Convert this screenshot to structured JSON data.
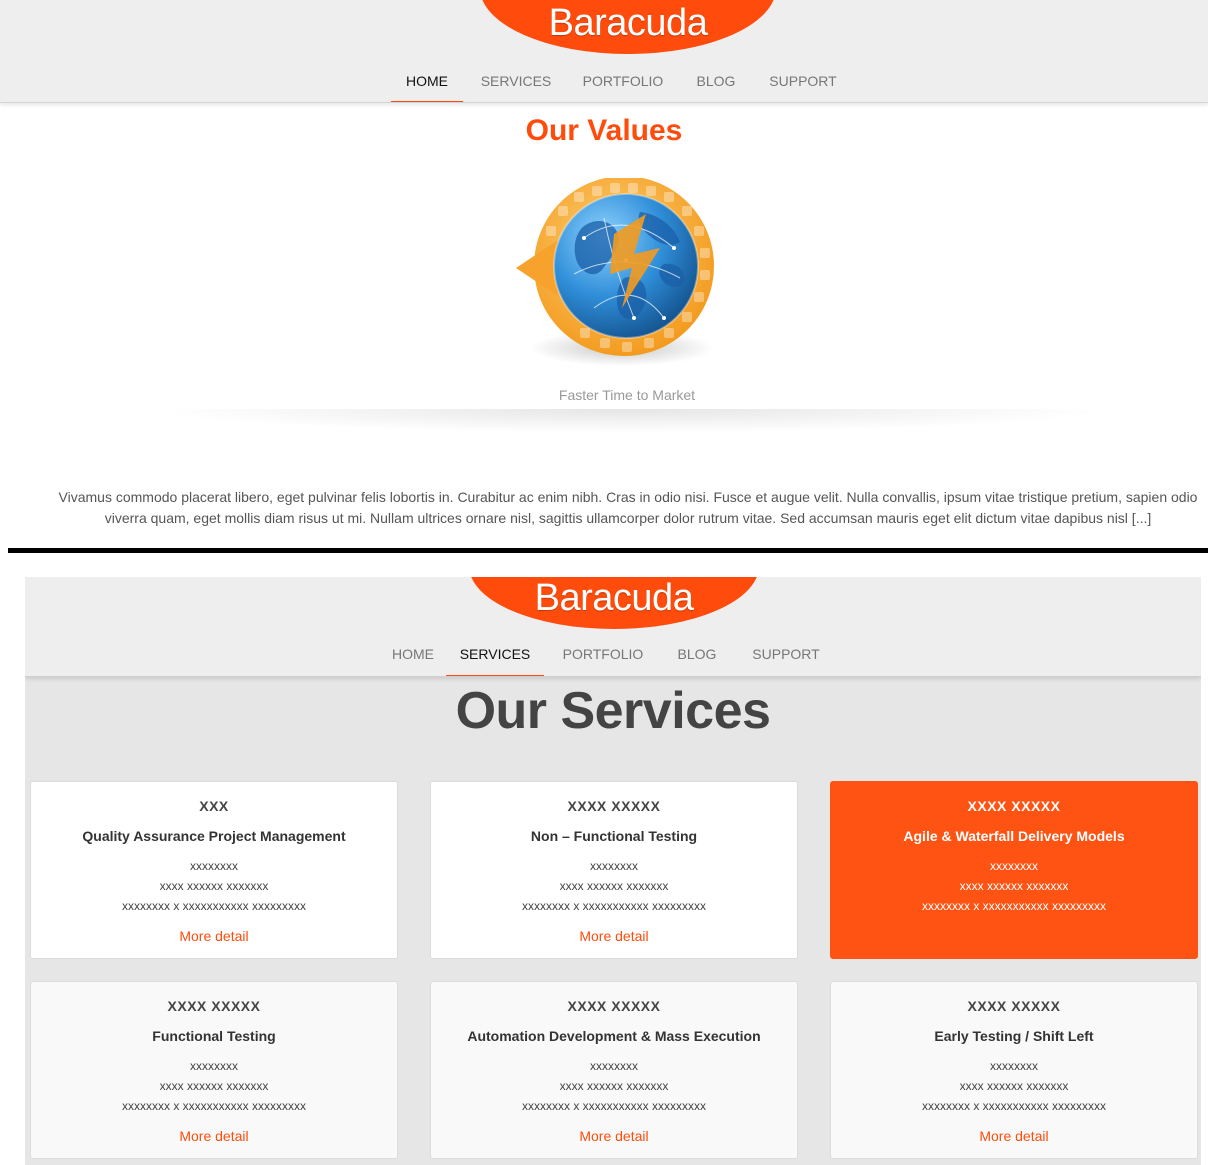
{
  "panel1": {
    "logo": "Baracuda",
    "nav": [
      "HOME",
      "SERVICES",
      "PORTFOLIO",
      "BLOG",
      "SUPPORT"
    ],
    "nav_active": "HOME",
    "title": "Our Values",
    "image": "globe-with-arrows",
    "caption": "Faster Time to Market",
    "paragraph": "Vivamus commodo placerat libero, eget pulvinar felis lobortis in. Curabitur ac enim nibh. Cras in odio nisi. Fusce et augue velit. Nulla convallis, ipsum vitae tristique pretium, sapien odio viverra quam, eget mollis diam risus ut mi. Nullam ultrices ornare nisl, sagittis ullamcorper dolor rutrum vitae. Sed accumsan mauris eget elit dictum vitae dapibus nisl [...]"
  },
  "panel2": {
    "logo": "Baracuda",
    "nav": [
      "HOME",
      "SERVICES",
      "PORTFOLIO",
      "BLOG",
      "SUPPORT"
    ],
    "nav_active": "SERVICES",
    "title": "Our Services",
    "cards": [
      {
        "title": "XXX",
        "subtitle": "Quality Assurance Project Management",
        "line1": "xxxxxxxx",
        "line2": "xxxx xxxxxx xxxxxxx",
        "line3": "xxxxxxxx x xxxxxxxxxxx xxxxxxxxx",
        "more": "More detail"
      },
      {
        "title": "XXXX XXXXX",
        "subtitle": "Non – Functional Testing",
        "line1": "xxxxxxxx",
        "line2": "xxxx xxxxxx xxxxxxx",
        "line3": "xxxxxxxx x xxxxxxxxxxx xxxxxxxxx",
        "more": "More detail"
      },
      {
        "title": "XXXX XXXXX",
        "subtitle": "Agile & Waterfall Delivery Models",
        "line1": "xxxxxxxx",
        "line2": "xxxx xxxxxx xxxxxxx",
        "line3": "xxxxxxxx x xxxxxxxxxxx xxxxxxxxx",
        "more": ""
      },
      {
        "title": "XXXX XXXXX",
        "subtitle": "Functional Testing",
        "line1": "xxxxxxxx",
        "line2": "xxxx xxxxxx xxxxxxx",
        "line3": "xxxxxxxx x xxxxxxxxxxx xxxxxxxxx",
        "more": "More detail"
      },
      {
        "title": "XXXX XXXXX",
        "subtitle": "Automation Development & Mass Execution",
        "line1": "xxxxxxxx",
        "line2": "xxxx xxxxxx xxxxxxx",
        "line3": "xxxxxxxx x xxxxxxxxxxx xxxxxxxxx",
        "more": "More detail"
      },
      {
        "title": "XXXX XXXXX",
        "subtitle": "Early Testing / Shift Left",
        "line1": "xxxxxxxx",
        "line2": "xxxx xxxxxx xxxxxxx",
        "line3": "xxxxxxxx x xxxxxxxxxxx xxxxxxxxx",
        "more": "More detail"
      }
    ]
  },
  "colors": {
    "accent": "#ff4c0d",
    "header_bg": "#eeeeee",
    "services_bg": "#e6e6e6"
  }
}
